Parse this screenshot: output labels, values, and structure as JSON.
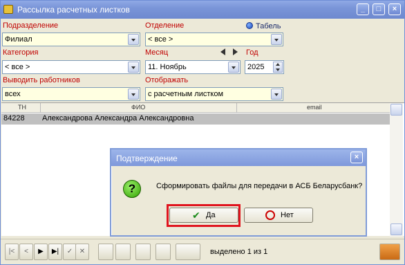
{
  "window": {
    "title": "Рассылка расчетных листков",
    "controls": [
      "_",
      "□",
      "×"
    ]
  },
  "filters": {
    "podrazdelenie": {
      "label": "Подразделение",
      "value": "Филиал"
    },
    "otdelenie": {
      "label": "Отделение",
      "value": "< все >"
    },
    "tabel": {
      "label": "Табель"
    },
    "kategoriya": {
      "label": "Категория",
      "value": "< все >"
    },
    "mesyac": {
      "label": "Месяц",
      "value": "11. Ноябрь"
    },
    "god": {
      "label": "Год",
      "value": "2025"
    },
    "vyvodit": {
      "label": "Выводить работников",
      "value": "всех"
    },
    "otobrazhat": {
      "label": "Отображать",
      "value": "с расчетным листком"
    }
  },
  "grid": {
    "columns": [
      "ТН",
      "ФИО",
      "email"
    ],
    "rows": [
      {
        "tn": "84228",
        "fio": "Александрова Александра Александровна",
        "email": ""
      }
    ]
  },
  "footer": {
    "status": "выделено 1 из 1"
  },
  "dialog": {
    "title": "Подтверждение",
    "message": "Сформировать файлы для передачи в АСБ Беларусбанк?",
    "yes_label": "Да",
    "no_label": "Нет"
  },
  "colors": {
    "label_red": "#c00000",
    "field_yellow": "#ffffe1",
    "highlight": "#e0141e",
    "titlebar": "#7a95d8"
  }
}
